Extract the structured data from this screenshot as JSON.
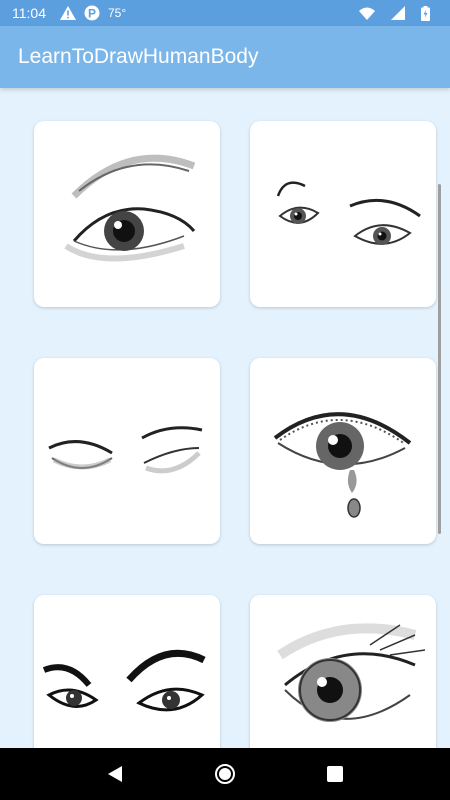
{
  "status_bar": {
    "time": "11:04",
    "temperature": "75°",
    "icons": [
      "warning-icon",
      "parking-icon",
      "wifi-icon",
      "signal-icon",
      "battery-icon"
    ]
  },
  "app_bar": {
    "title": "LearnToDrawHumanBody"
  },
  "gallery": {
    "items": [
      {
        "icon": "eye-sketch-image"
      },
      {
        "icon": "eyes-pair-sketch-image"
      },
      {
        "icon": "closed-eyes-sketch-image"
      },
      {
        "icon": "crying-eye-sketch-image"
      },
      {
        "icon": "dramatic-eyes-sketch-image"
      },
      {
        "icon": "realistic-eye-sketch-image"
      }
    ]
  },
  "nav_bar": {
    "icons": [
      "back-icon",
      "home-icon",
      "recents-icon"
    ]
  },
  "colors": {
    "status_bar": "#5c9fde",
    "app_bar": "#7ab6ea",
    "background": "#e3f2fd"
  }
}
